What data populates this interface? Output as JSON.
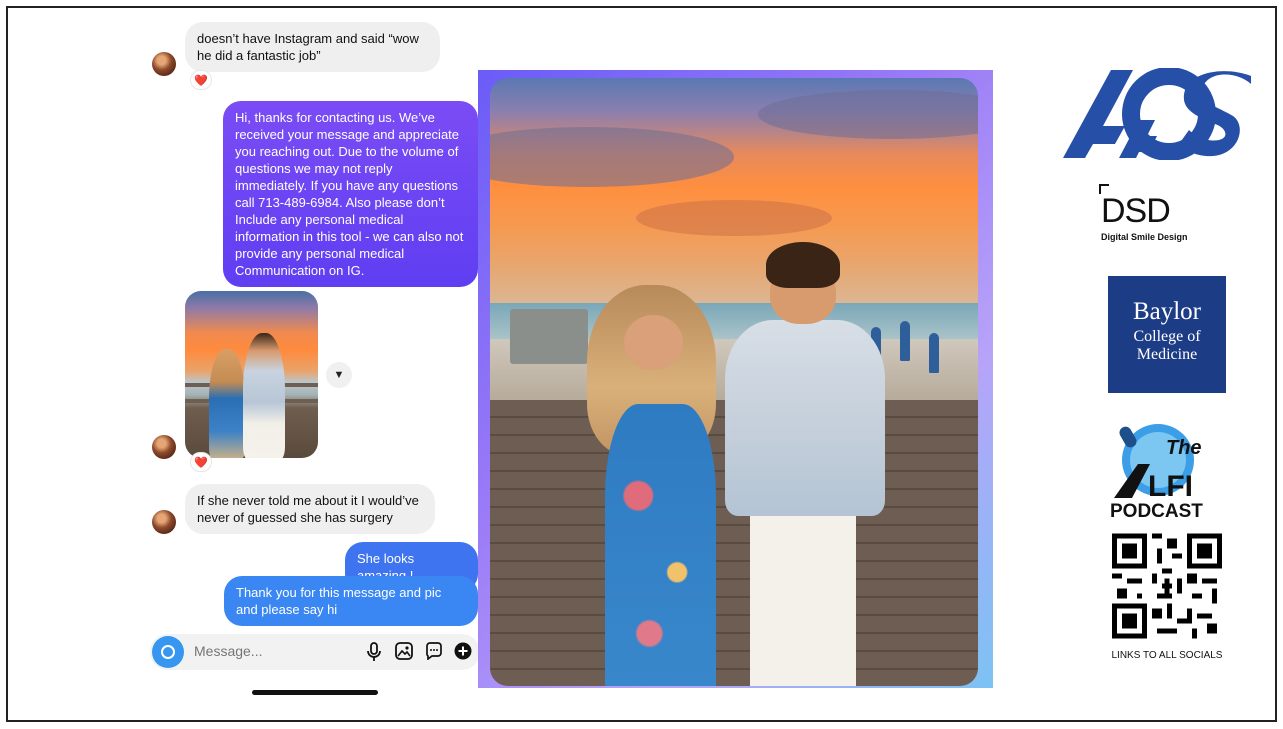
{
  "chat": {
    "messages": [
      {
        "side": "in",
        "text": "doesn’t have Instagram and said “wow he did a fantastic job”",
        "reaction": "❤️"
      },
      {
        "side": "out",
        "text": "Hi, thanks for contacting us. We’ve received your message and appreciate you reaching out. Due to the volume of questions we may not reply immediately. If you have any questions call 713-489-6984. Also please don’t Include any personal medical information in this tool - we can also not provide any personal medical Communication on IG."
      },
      {
        "side": "in",
        "type": "photo",
        "reaction": "❤️"
      },
      {
        "side": "in",
        "text": "If she never told me about it I would’ve never of guessed she has surgery"
      },
      {
        "side": "out",
        "text": "She looks amazing !"
      },
      {
        "side": "out",
        "text": "Thank you for this message and pic and please say hi"
      }
    ],
    "composer_placeholder": "Message...",
    "colors": {
      "bubble_purple": "#6a3cf5",
      "bubble_blue": "#3a78f2",
      "bubble_in": "#efefef",
      "accent": "#3797f0"
    }
  },
  "logos": {
    "aos": "AOS",
    "dsd": "DSD",
    "dsd_sub": "Digital Smile Design",
    "baylor": [
      "Baylor",
      "College of",
      "Medicine"
    ],
    "alfi": {
      "top": "The",
      "main": "ALFI",
      "bottom": "PODCAST"
    },
    "socials": "LINKS TO ALL SOCIALS"
  },
  "icons": [
    "camera-icon",
    "microphone-icon",
    "gallery-icon",
    "sticker-icon",
    "add-icon",
    "share-icon",
    "heart-icon"
  ]
}
